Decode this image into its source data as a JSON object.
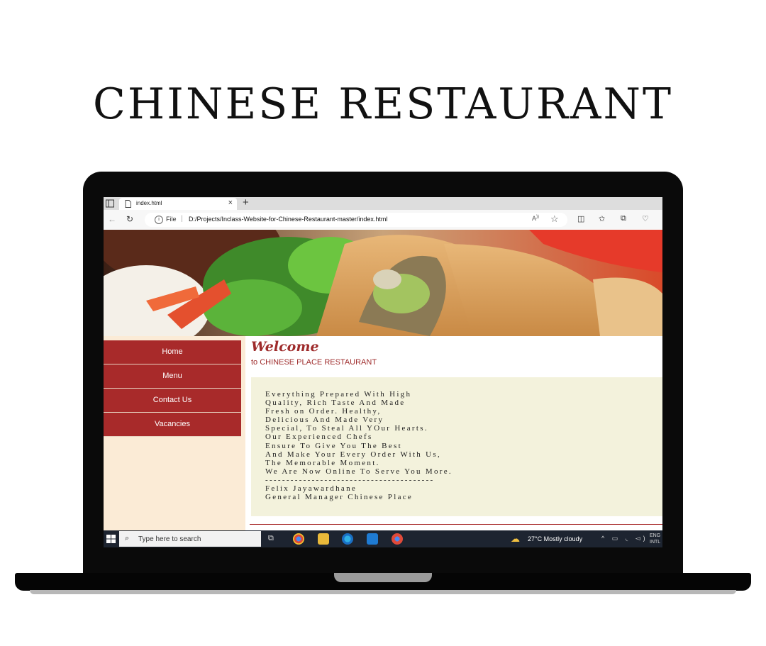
{
  "page": {
    "title": "CHINESE RESTAURANT"
  },
  "browser": {
    "tab_title": "index.html",
    "url_scheme": "File",
    "url": "D:/Projects/Inclass-Website-for-Chinese-Restaurant-master/index.html"
  },
  "site": {
    "nav": [
      {
        "label": "Home"
      },
      {
        "label": "Menu"
      },
      {
        "label": "Contact Us"
      },
      {
        "label": "Vacancies"
      }
    ],
    "welcome": "Welcome",
    "subtitle": "to CHINESE PLACE RESTAURANT",
    "content_lines": [
      "Everything Prepared With High",
      "Quality, Rich Taste And Made",
      "Fresh on Order. Healthy,",
      "Delicious And Made Very",
      "Special, To Steal All YOur Hearts.",
      "Our Experienced Chefs",
      "Ensure To Give You The Best",
      "And Make Your Every Order With Us,",
      "The Memorable Moment.",
      "We Are Now Online To Serve You More.",
      "----------------------------------------",
      "Felix Jayawardhane",
      "General Manager Chinese Place"
    ]
  },
  "taskbar": {
    "search_placeholder": "Type here to search",
    "weather": "27°C  Mostly cloudy",
    "language": "ENG",
    "language_sub": "INTL"
  }
}
